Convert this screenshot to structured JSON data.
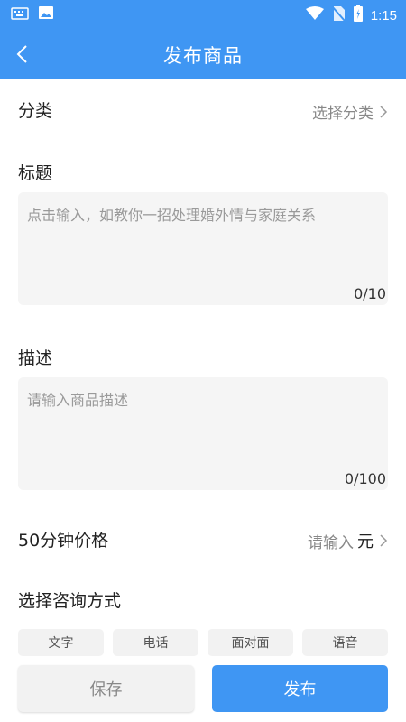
{
  "status_bar": {
    "time": "1:15"
  },
  "header": {
    "title": "发布商品"
  },
  "category": {
    "label": "分类",
    "value": "选择分类"
  },
  "title_field": {
    "label": "标题",
    "placeholder": "点击输入，如教你一招处理婚外情与家庭关系",
    "counter": "0/10"
  },
  "description_field": {
    "label": "描述",
    "placeholder": "请输入商品描述",
    "counter": "0/100"
  },
  "price": {
    "label": "50分钟价格",
    "placeholder": "请输入",
    "unit": "元"
  },
  "consult": {
    "label": "选择咨询方式",
    "options": [
      "文字",
      "电话",
      "面对面",
      "语音"
    ]
  },
  "actions": {
    "save": "保存",
    "publish": "发布"
  },
  "colors": {
    "primary": "#3f96f3",
    "input_bg": "#f5f5f5"
  }
}
